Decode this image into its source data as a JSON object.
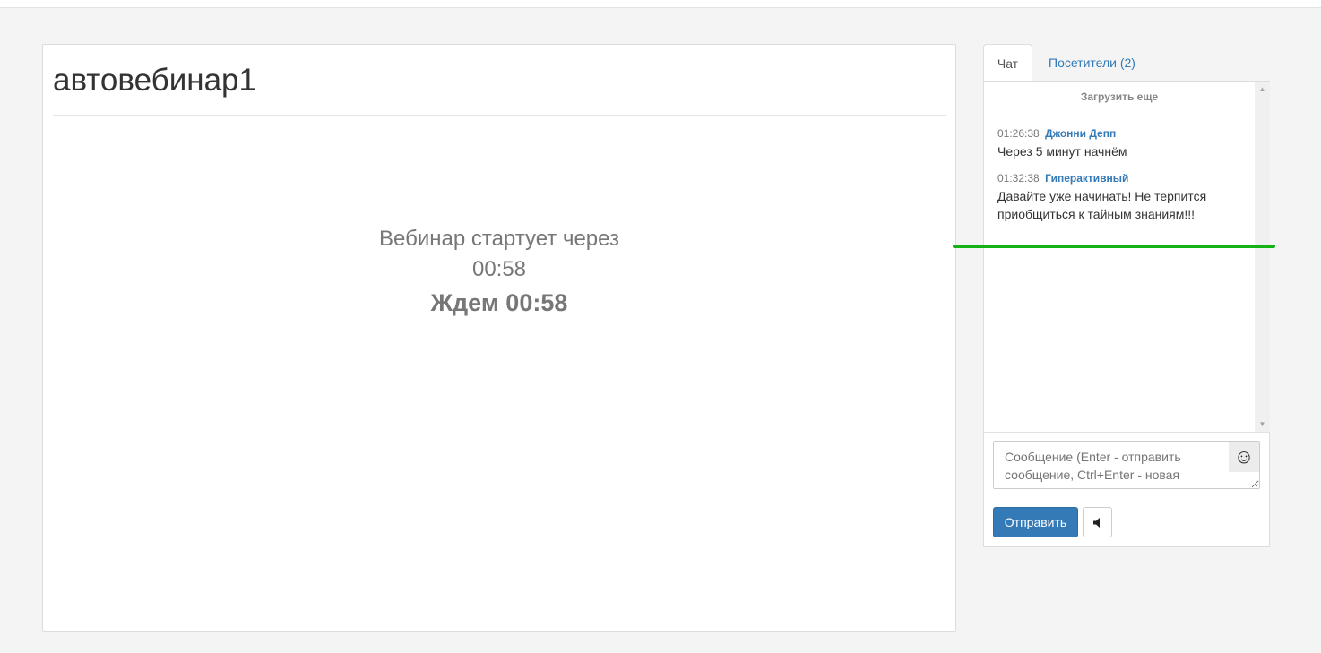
{
  "main": {
    "title": "автовебинар1",
    "countdown": {
      "starts_in_label": "Вебинар стартует через",
      "timer": "00:58",
      "waiting_label": "Ждем 00:58"
    }
  },
  "chat": {
    "tabs": [
      {
        "label": "Чат",
        "active": true
      },
      {
        "label": "Посетители (2)",
        "active": false
      }
    ],
    "load_more": "Загрузить еще",
    "messages": [
      {
        "time": "01:26:38",
        "author": "Джонни Депп",
        "text": "Через 5 минут начнём"
      },
      {
        "time": "01:32:38",
        "author": "Гиперактивный",
        "text": "Давайте уже начинать! Не терпится приобщиться к тайным знаниям!!!"
      }
    ],
    "input_placeholder": "Сообщение (Enter - отправить сообщение, Ctrl+Enter - новая строка)",
    "send_label": "Отправить",
    "emoji_icon": "smiley-icon",
    "sound_icon": "speaker-icon"
  },
  "colors": {
    "accent": "#337ab7",
    "annotation": "#15b215",
    "background": "#f4f4f4"
  }
}
